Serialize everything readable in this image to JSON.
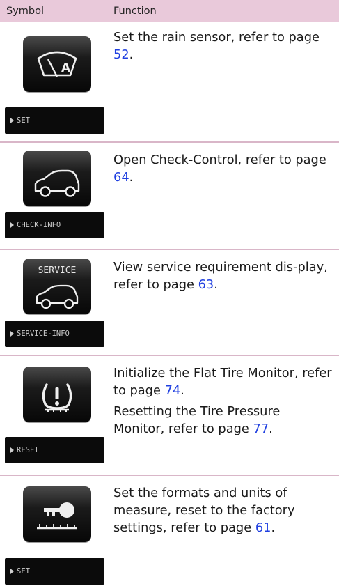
{
  "header": {
    "symbol": "Symbol",
    "function": "Function"
  },
  "rows": [
    {
      "bar_label": "SET",
      "lines": [
        {
          "pre": "Set the rain sensor, refer to page ",
          "page": "52",
          "post": "."
        }
      ]
    },
    {
      "bar_label": "CHECK-INFO",
      "lines": [
        {
          "pre": "Open Check-Control, refer to page ",
          "page": "64",
          "post": "."
        }
      ]
    },
    {
      "icon_text": "SERVICE",
      "bar_label": "SERVICE-INFO",
      "lines": [
        {
          "pre": "View service requirement dis-play, refer to page ",
          "page": "63",
          "post": "."
        }
      ]
    },
    {
      "bar_label": "RESET",
      "lines": [
        {
          "pre": "Initialize the Flat Tire Monitor, refer to page ",
          "page": "74",
          "post": "."
        },
        {
          "pre": "Resetting the Tire Pressure Monitor, refer to page ",
          "page": "77",
          "post": "."
        }
      ]
    },
    {
      "bar_label": "SET",
      "lines": [
        {
          "pre": "Set the formats and units of measure, reset to the factory settings, refer to page ",
          "page": "61",
          "post": "."
        }
      ]
    }
  ],
  "icons": [
    "wiper-rain-sensor-icon",
    "car-icon",
    "service-car-icon",
    "tire-pressure-warning-icon",
    "key-settings-icon"
  ],
  "colors": {
    "header_bg": "#e9c9da",
    "divider": "#d9b6c8",
    "link": "#1f3fe0"
  }
}
